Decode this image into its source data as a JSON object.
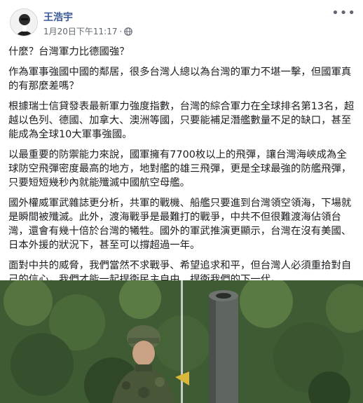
{
  "post": {
    "author": "王浩宇",
    "timestamp": "1月20日下午11:17",
    "separator": "·",
    "privacy_icon": "globe-icon",
    "more_icon": "more-options-icon",
    "paragraphs": [
      "什麼？台灣軍力比德國強？",
      "作為軍事強國中國的鄰居，很多台灣人總以為台灣的軍力不堪一擊，但國軍真的有那麼差嗎？",
      "根據瑞士信貸發表最新軍力強度指數，台灣的綜合軍力在全球排名第13名，超越以色列、德國、加拿大、澳洲等國，只要能補足潛艦數量不足的缺口，甚至能成為全球10大軍事強國。",
      "以最重要的防禦能力來說，國軍擁有7700枚以上的飛彈，讓台灣海峽成為全球防空飛彈密度最高的地方，地對艦的雄三飛彈，更是全球最強的防艦飛彈，只要短短幾秒內就能殲滅中國航空母艦。",
      "國外權威軍武雜誌更分析，共軍的戰機、船艦只要進到台灣領空領海，下場就是瞬間被殲滅。此外，渡海戰爭是最難打的戰爭，中共不但很難渡海佔領台灣，還會有幾十倍於台灣的犧牲。國外的軍武推演更顯示，台灣在沒有美國、日本外援的狀況下，甚至可以撐超過一年。",
      "面對中共的威脅，我們當然不求戰爭、希望追求和平，但台灣人必須重拾對自己的信心，我們才能一起捍衛民主自由、捍衛我們的下一代。"
    ]
  }
}
